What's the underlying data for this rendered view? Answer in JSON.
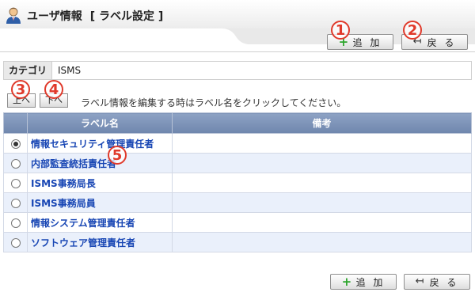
{
  "header": {
    "title": "ユーザ情報",
    "subtitle": "[ ラベル設定 ]",
    "icon": "user-icon"
  },
  "toolbar": {
    "add_label": "追 加",
    "back_label": "戻 る",
    "add_icon": "plus-icon",
    "back_icon": "return-arrow-icon"
  },
  "callouts": [
    "1",
    "2",
    "3",
    "4",
    "5"
  ],
  "category": {
    "label": "カテゴリ",
    "value": "ISMS"
  },
  "order": {
    "up_label": "上へ",
    "down_label": "下へ",
    "hint": "ラベル情報を編集する時はラベル名をクリックしてください。"
  },
  "table": {
    "columns": [
      "",
      "ラベル名",
      "備考"
    ],
    "rows": [
      {
        "name": "情報セキュリティ管理責任者",
        "note": "",
        "selected": true
      },
      {
        "name": "内部監査統括責任者",
        "note": "",
        "selected": false
      },
      {
        "name": "ISMS事務局長",
        "note": "",
        "selected": false
      },
      {
        "name": "ISMS事務局員",
        "note": "",
        "selected": false
      },
      {
        "name": "情報システム管理責任者",
        "note": "",
        "selected": false
      },
      {
        "name": "ソフトウェア管理責任者",
        "note": "",
        "selected": false
      }
    ]
  },
  "colors": {
    "header_row": "#7b90b6",
    "link": "#1846b4",
    "callout": "#e03a2b",
    "alt_row": "#eaf0fb"
  }
}
